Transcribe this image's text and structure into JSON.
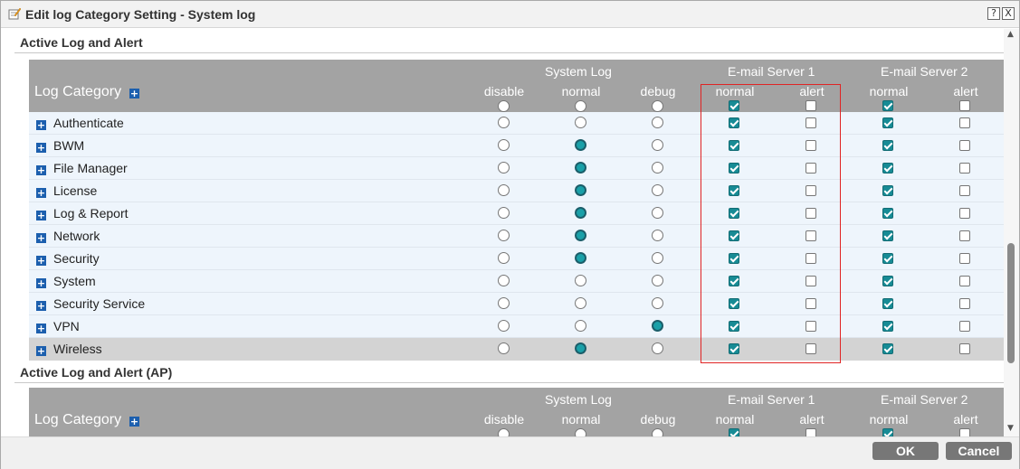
{
  "window": {
    "title": "Edit log Category Setting - System log",
    "help_label": "?",
    "close_label": "X"
  },
  "colors": {
    "header_bg": "#a3a3a3",
    "row_bg": "#eef5fc",
    "selected_row_bg": "#d3d3d3",
    "accent": "#178b95",
    "highlight_box": "#e02424"
  },
  "sections": [
    {
      "title": "Active Log and Alert",
      "header": {
        "log_category": "Log Category",
        "group_system_log": "System Log",
        "group_email1": "E-mail Server 1",
        "group_email2": "E-mail Server 2",
        "col_disable": "disable",
        "col_normal": "normal",
        "col_debug": "debug",
        "col_e1_normal": "normal",
        "col_e1_alert": "alert",
        "col_e2_normal": "normal",
        "col_e2_alert": "alert",
        "header_controls": {
          "disable": false,
          "normal": false,
          "debug": false,
          "e1_normal": true,
          "e1_alert": false,
          "e2_normal": true,
          "e2_alert": false
        }
      },
      "rows": [
        {
          "name": "Authenticate",
          "system_log": "none",
          "e1_normal": true,
          "e1_alert": false,
          "e2_normal": true,
          "e2_alert": false
        },
        {
          "name": "BWM",
          "system_log": "normal",
          "e1_normal": true,
          "e1_alert": false,
          "e2_normal": true,
          "e2_alert": false
        },
        {
          "name": "File Manager",
          "system_log": "normal",
          "e1_normal": true,
          "e1_alert": false,
          "e2_normal": true,
          "e2_alert": false
        },
        {
          "name": "License",
          "system_log": "normal",
          "e1_normal": true,
          "e1_alert": false,
          "e2_normal": true,
          "e2_alert": false
        },
        {
          "name": "Log & Report",
          "system_log": "normal",
          "e1_normal": true,
          "e1_alert": false,
          "e2_normal": true,
          "e2_alert": false
        },
        {
          "name": "Network",
          "system_log": "normal",
          "e1_normal": true,
          "e1_alert": false,
          "e2_normal": true,
          "e2_alert": false
        },
        {
          "name": "Security",
          "system_log": "normal",
          "e1_normal": true,
          "e1_alert": false,
          "e2_normal": true,
          "e2_alert": false
        },
        {
          "name": "System",
          "system_log": "none",
          "e1_normal": true,
          "e1_alert": false,
          "e2_normal": true,
          "e2_alert": false
        },
        {
          "name": "Security Service",
          "system_log": "none",
          "e1_normal": true,
          "e1_alert": false,
          "e2_normal": true,
          "e2_alert": false
        },
        {
          "name": "VPN",
          "system_log": "debug",
          "e1_normal": true,
          "e1_alert": false,
          "e2_normal": true,
          "e2_alert": false
        },
        {
          "name": "Wireless",
          "system_log": "normal",
          "e1_normal": true,
          "e1_alert": false,
          "e2_normal": true,
          "e2_alert": false,
          "selected": true
        }
      ]
    },
    {
      "title": "Active Log and Alert (AP)",
      "header": {
        "log_category": "Log Category",
        "group_system_log": "System Log",
        "group_email1": "E-mail Server 1",
        "group_email2": "E-mail Server 2",
        "col_disable": "disable",
        "col_normal": "normal",
        "col_debug": "debug",
        "col_e1_normal": "normal",
        "col_e1_alert": "alert",
        "col_e2_normal": "normal",
        "col_e2_alert": "alert",
        "header_controls": {
          "disable": false,
          "normal": false,
          "debug": false,
          "e1_normal": true,
          "e1_alert": false,
          "e2_normal": true,
          "e2_alert": false
        }
      },
      "rows": []
    }
  ],
  "footer": {
    "ok_label": "OK",
    "cancel_label": "Cancel"
  }
}
